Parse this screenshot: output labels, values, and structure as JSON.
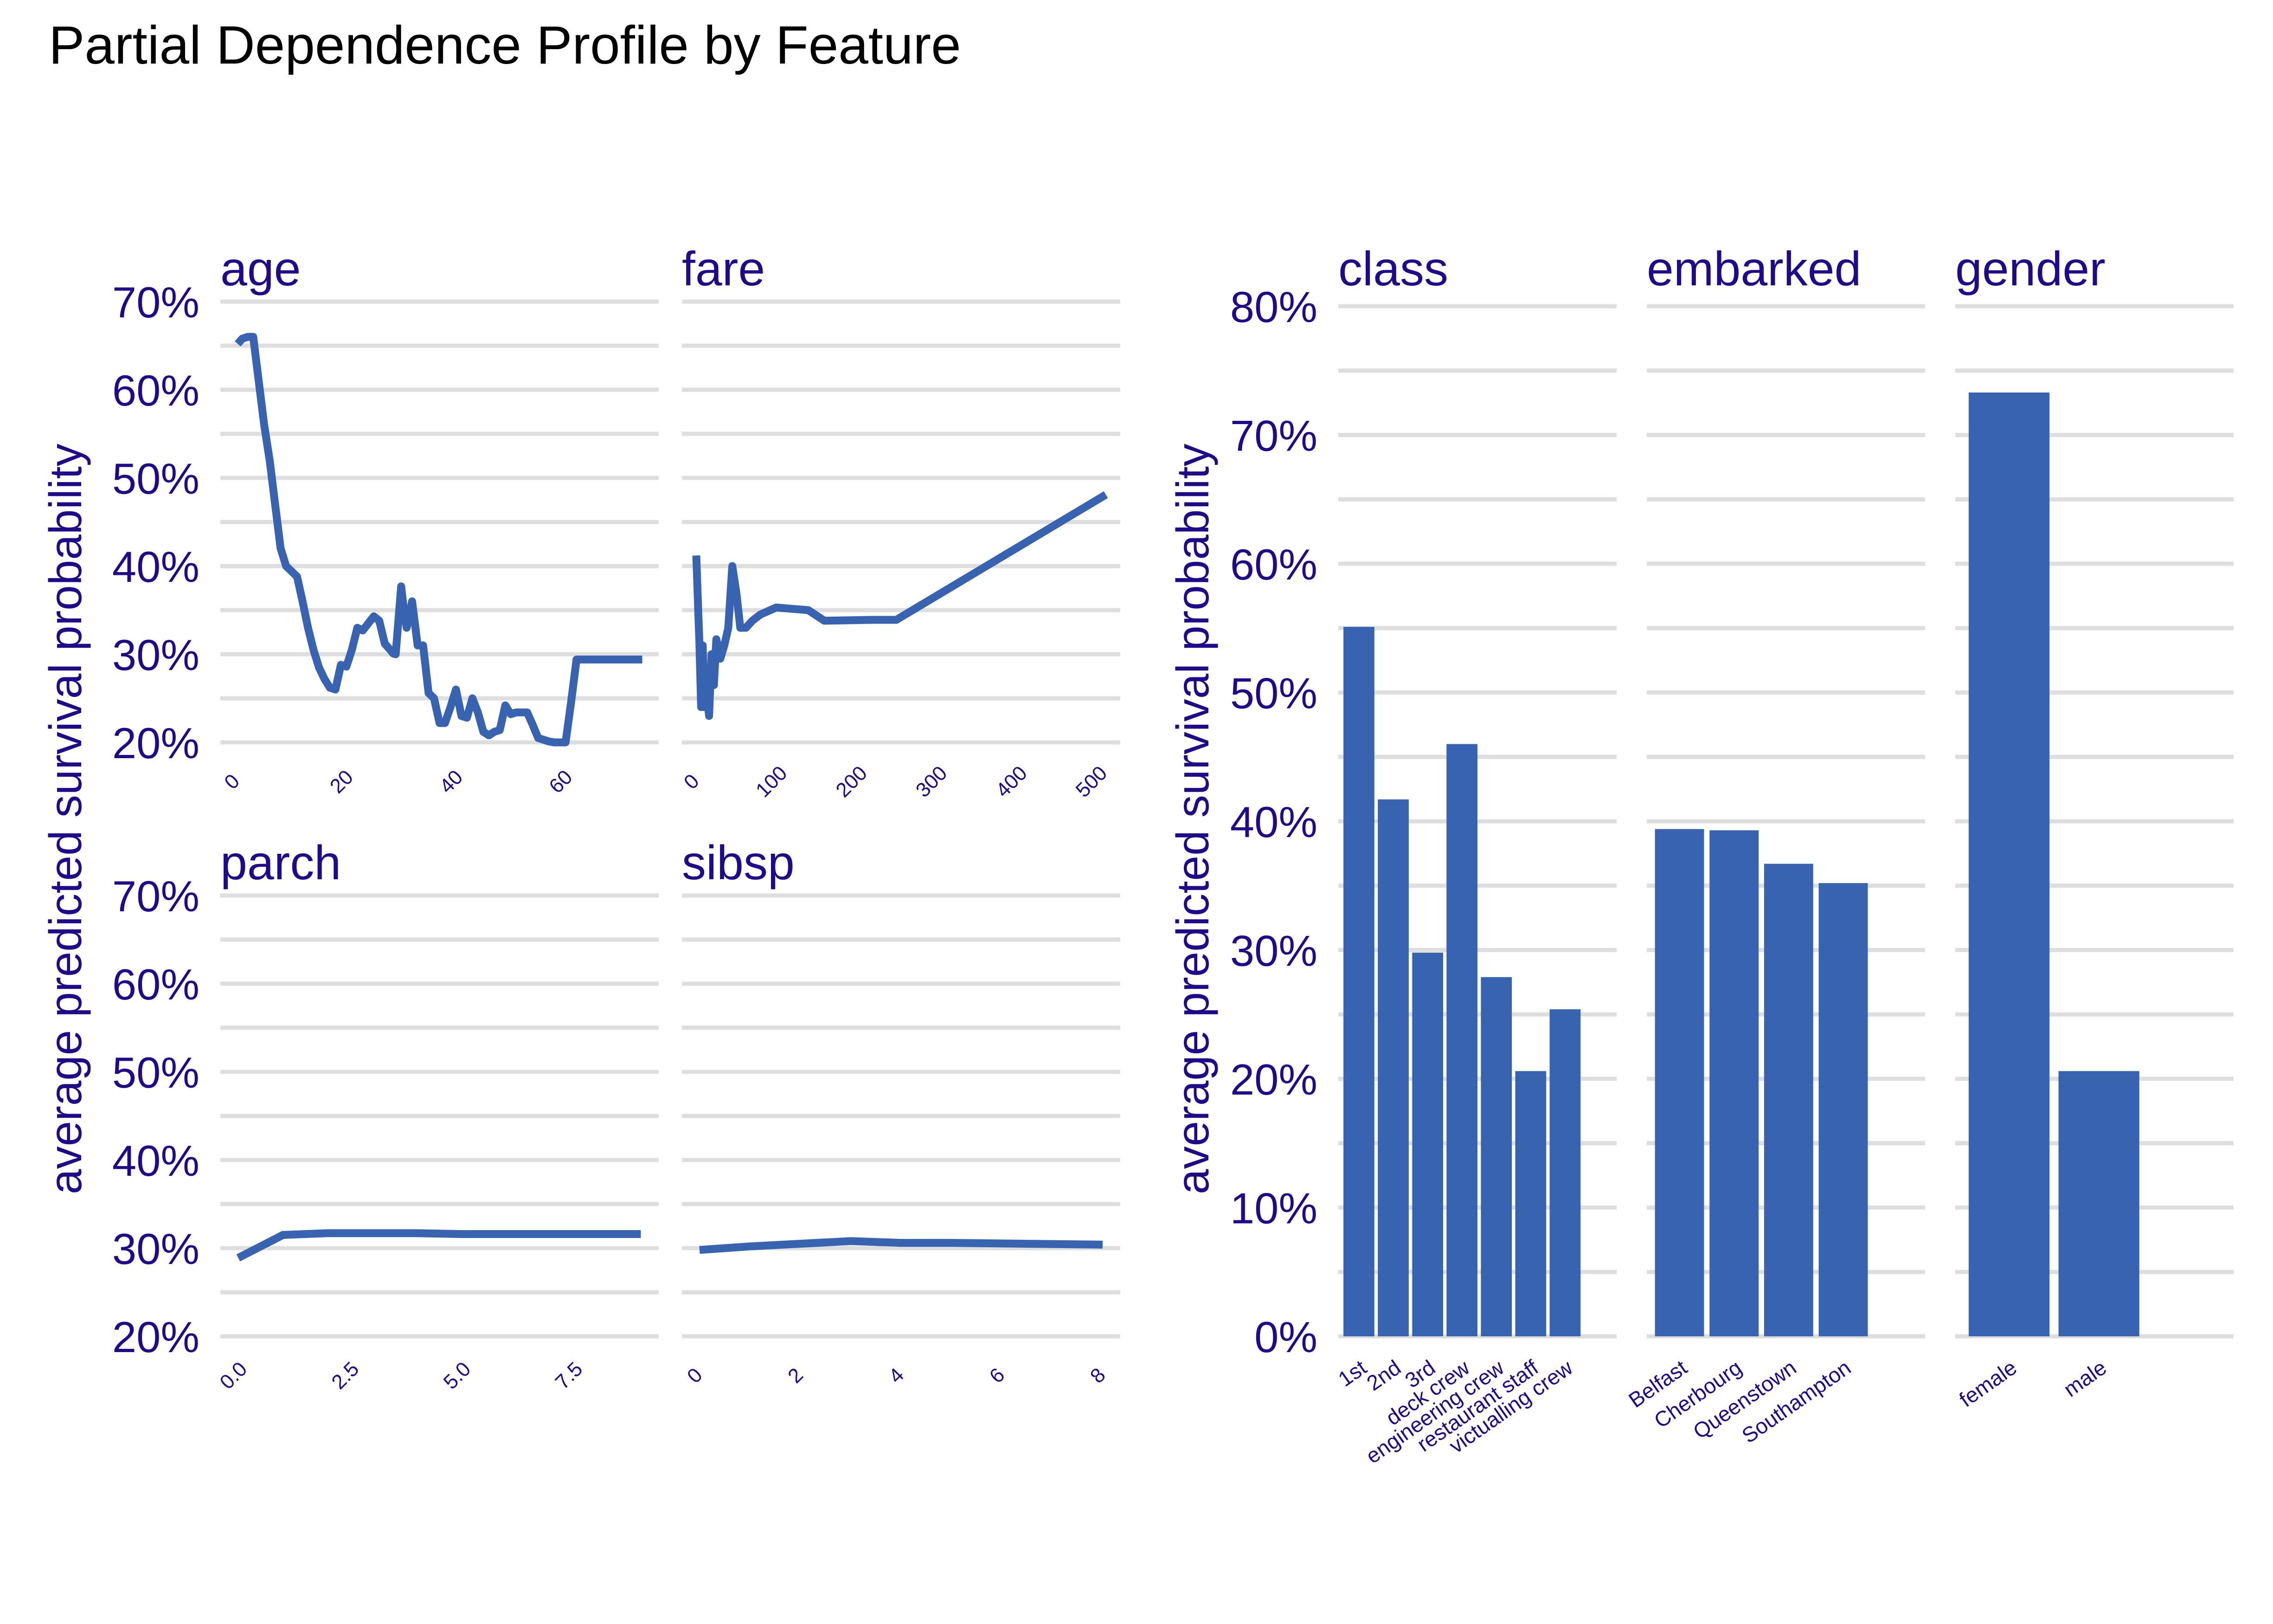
{
  "title": "Partial Dependence Profile by Feature",
  "colors": {
    "text": "#1f0a8c",
    "line": "#3863b0",
    "bar": "#3863b0",
    "grid": "#dedede",
    "title": "#000000"
  },
  "chart_data": [
    {
      "type": "line",
      "group": "numeric",
      "ylabel": "average predicted survival probability",
      "ylim": [
        0.2,
        0.7
      ],
      "yticks": [
        0.2,
        0.3,
        0.4,
        0.5,
        0.6,
        0.7
      ],
      "ytick_labels": [
        "20%",
        "30%",
        "40%",
        "50%",
        "60%",
        "70%"
      ],
      "panels": [
        {
          "name": "age",
          "xticks": [
            0,
            20,
            40,
            60
          ],
          "xtick_labels": [
            "0",
            "20",
            "40",
            "60"
          ],
          "xlim": [
            -3,
            77
          ],
          "x": [
            0.17,
            1,
            2,
            3,
            4,
            5,
            6,
            7,
            8,
            9,
            10,
            11,
            12,
            13,
            14,
            15,
            16,
            17,
            18,
            19,
            20,
            21,
            22,
            23,
            24,
            25,
            26,
            27,
            28,
            28.5,
            29,
            30,
            30.5,
            31,
            32,
            33,
            34,
            35,
            36,
            37,
            38,
            39,
            40,
            41,
            42,
            43,
            44,
            45,
            45.5,
            46,
            47,
            48,
            49,
            50,
            51,
            52,
            53,
            54,
            55,
            56,
            57,
            58,
            59,
            60,
            61,
            62,
            63,
            64,
            65,
            66,
            67,
            70,
            71,
            74
          ],
          "y": [
            0.652,
            0.658,
            0.66,
            0.66,
            0.61,
            0.56,
            0.52,
            0.47,
            0.42,
            0.4,
            0.394,
            0.388,
            0.36,
            0.33,
            0.305,
            0.285,
            0.272,
            0.262,
            0.26,
            0.288,
            0.286,
            0.305,
            0.33,
            0.327,
            0.335,
            0.343,
            0.338,
            0.312,
            0.305,
            0.301,
            0.3,
            0.377,
            0.35,
            0.33,
            0.36,
            0.31,
            0.31,
            0.256,
            0.25,
            0.222,
            0.222,
            0.24,
            0.26,
            0.23,
            0.228,
            0.25,
            0.234,
            0.212,
            0.21,
            0.208,
            0.212,
            0.214,
            0.242,
            0.232,
            0.234,
            0.234,
            0.234,
            0.22,
            0.205,
            0.203,
            0.201,
            0.2,
            0.2,
            0.2,
            0.245,
            0.294,
            0.294,
            0.294,
            0.294,
            0.294,
            0.294,
            0.294,
            0.294,
            0.294
          ]
        },
        {
          "name": "fare",
          "xticks": [
            0,
            100,
            200,
            300,
            400,
            500
          ],
          "xtick_labels": [
            "0",
            "100",
            "200",
            "300",
            "400",
            "500"
          ],
          "xlim": [
            -18,
            530
          ],
          "x": [
            0,
            4,
            6,
            8,
            10,
            13,
            16,
            19,
            22,
            25,
            30,
            35,
            40,
            45,
            50,
            55,
            62,
            70,
            80,
            100,
            140,
            160,
            220,
            250,
            512
          ],
          "y": [
            0.412,
            0.31,
            0.24,
            0.31,
            0.24,
            0.255,
            0.23,
            0.3,
            0.265,
            0.317,
            0.295,
            0.31,
            0.33,
            0.4,
            0.37,
            0.33,
            0.33,
            0.338,
            0.345,
            0.353,
            0.35,
            0.338,
            0.339,
            0.339,
            0.481
          ]
        },
        {
          "name": "parch",
          "xticks": [
            0,
            2.5,
            5,
            7.5
          ],
          "xtick_labels": [
            "0.0",
            "2.5",
            "5.0",
            "7.5"
          ],
          "xlim": [
            -0.4,
            9.4
          ],
          "x": [
            0,
            1,
            2,
            3,
            4,
            5,
            6,
            9
          ],
          "y": [
            0.289,
            0.315,
            0.317,
            0.317,
            0.317,
            0.316,
            0.316,
            0.316
          ]
        },
        {
          "name": "sibsp",
          "xticks": [
            0,
            2,
            4,
            6,
            8
          ],
          "xtick_labels": [
            "0",
            "2",
            "4",
            "6",
            "8"
          ],
          "xlim": [
            -0.35,
            8.35
          ],
          "x": [
            0,
            1,
            2,
            3,
            4,
            5,
            8
          ],
          "y": [
            0.298,
            0.302,
            0.305,
            0.308,
            0.306,
            0.306,
            0.304
          ]
        }
      ]
    },
    {
      "type": "bar",
      "group": "categorical",
      "ylabel": "average predicted survival probability",
      "ylim": [
        0,
        0.8
      ],
      "yticks": [
        0,
        0.1,
        0.2,
        0.3,
        0.4,
        0.5,
        0.6,
        0.7,
        0.8
      ],
      "ytick_labels": [
        "0%",
        "10%",
        "20%",
        "30%",
        "40%",
        "50%",
        "60%",
        "70%",
        "80%"
      ],
      "panels": [
        {
          "name": "class",
          "categories": [
            "1st",
            "2nd",
            "3rd",
            "deck crew",
            "engineering crew",
            "restaurant staff",
            "victualling crew"
          ],
          "values": [
            0.551,
            0.417,
            0.298,
            0.46,
            0.279,
            0.206,
            0.254
          ]
        },
        {
          "name": "embarked",
          "categories": [
            "Belfast",
            "Cherbourg",
            "Queenstown",
            "Southampton"
          ],
          "values": [
            0.394,
            0.393,
            0.367,
            0.352
          ]
        },
        {
          "name": "gender",
          "categories": [
            "female",
            "male"
          ],
          "values": [
            0.733,
            0.206
          ]
        }
      ]
    }
  ]
}
